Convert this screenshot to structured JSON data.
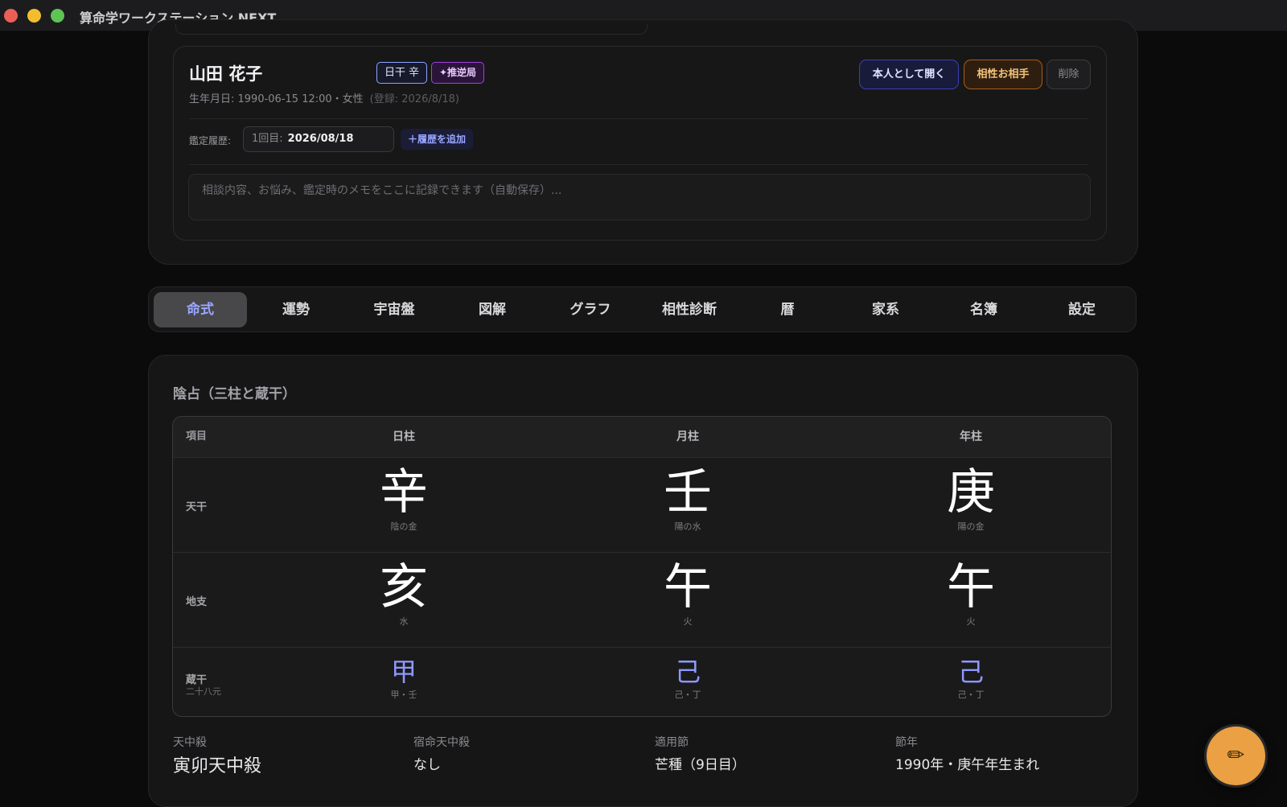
{
  "app": {
    "title": "算命学ワークステーション NEXT"
  },
  "profile": {
    "name": "山田 花子",
    "day_stem_badge": "日干 辛",
    "kyoku_badge": "✦推逆局",
    "birth_info": "生年月日: 1990-06-15 12:00・女性",
    "registered": "(登録: 2026/8/18)",
    "buttons": {
      "open_self": "本人として開く",
      "partner": "相性お相手",
      "delete": "削除"
    },
    "history": {
      "label": "鑑定履歴:",
      "count": "1回目:",
      "date": "2026/08/18",
      "add": "＋履歴を追加"
    },
    "memo_placeholder": "相談内容、お悩み、鑑定時のメモをここに記録できます（自動保存）..."
  },
  "tabs": [
    "命式",
    "運勢",
    "宇宙盤",
    "図解",
    "グラフ",
    "相性診断",
    "暦",
    "家系",
    "名簿",
    "設定"
  ],
  "active_tab": "命式",
  "section": {
    "title": "陰占（三柱と蔵干）",
    "table": {
      "headers": {
        "item": "項目",
        "day": "日柱",
        "month": "月柱",
        "year": "年柱"
      },
      "rows": {
        "stem": {
          "label": "天干",
          "day": {
            "char": "辛",
            "note": "陰の金"
          },
          "month": {
            "char": "壬",
            "note": "陽の水"
          },
          "year": {
            "char": "庚",
            "note": "陽の金"
          }
        },
        "branch": {
          "label": "地支",
          "day": {
            "char": "亥",
            "note": "水"
          },
          "month": {
            "char": "午",
            "note": "火"
          },
          "year": {
            "char": "午",
            "note": "火"
          }
        },
        "zokan": {
          "label": "蔵干",
          "sub": "二十八元",
          "day": {
            "char": "甲",
            "note": "甲・壬"
          },
          "month": {
            "char": "己",
            "note": "己・丁"
          },
          "year": {
            "char": "己",
            "note": "己・丁"
          }
        }
      }
    }
  },
  "info": {
    "tenchusatsu": {
      "label": "天中殺",
      "value": "寅卯天中殺"
    },
    "shukumei": {
      "label": "宿命天中殺",
      "value": "なし"
    },
    "setsu": {
      "label": "適用節",
      "value": "芒種（9日目）"
    },
    "setsunen": {
      "label": "節年",
      "value": "1990年・庚午年生まれ"
    }
  },
  "fab_icon": "pencil-icon",
  "colors": {
    "accent": "#9aa7ff",
    "fab": "#eaa043",
    "partner": "#f4c27a"
  }
}
